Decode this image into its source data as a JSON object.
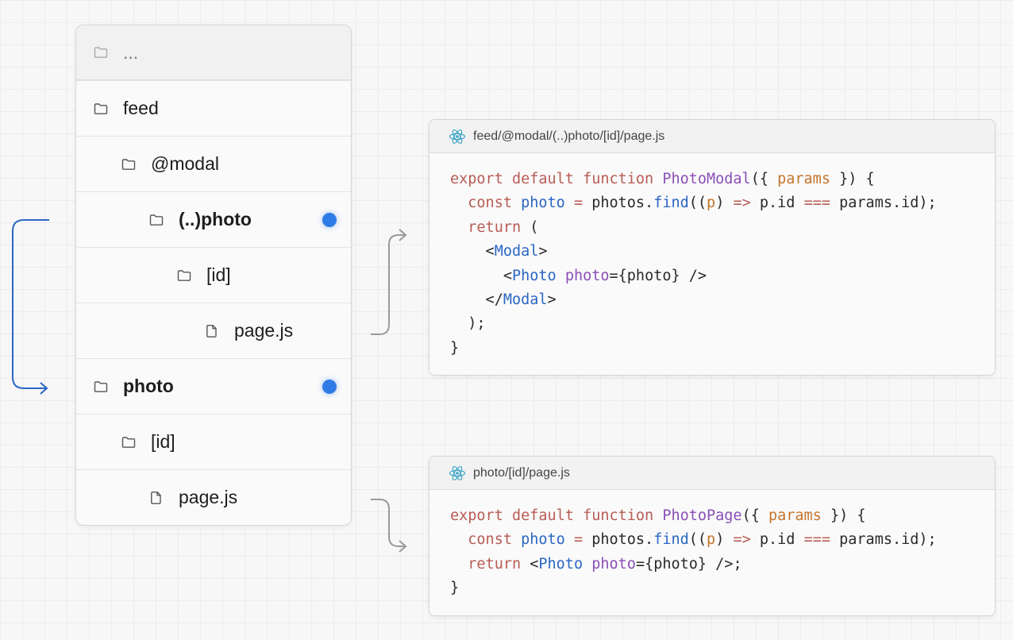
{
  "tree": {
    "rows": [
      {
        "label": "...",
        "type": "folder",
        "indent": 0,
        "bold": false,
        "dim": true,
        "dot": false
      },
      {
        "label": "feed",
        "type": "folder",
        "indent": 0,
        "bold": false,
        "dim": false,
        "dot": false
      },
      {
        "label": "@modal",
        "type": "folder",
        "indent": 1,
        "bold": false,
        "dim": false,
        "dot": false
      },
      {
        "label": "(..)photo",
        "type": "folder",
        "indent": 2,
        "bold": true,
        "dim": false,
        "dot": true
      },
      {
        "label": "[id]",
        "type": "folder",
        "indent": 3,
        "bold": false,
        "dim": false,
        "dot": false
      },
      {
        "label": "page.js",
        "type": "file",
        "indent": 4,
        "bold": false,
        "dim": false,
        "dot": false
      },
      {
        "label": "photo",
        "type": "folder",
        "indent": 0,
        "bold": true,
        "dim": false,
        "dot": true
      },
      {
        "label": "[id]",
        "type": "folder",
        "indent": 1,
        "bold": false,
        "dim": false,
        "dot": false
      },
      {
        "label": "page.js",
        "type": "file",
        "indent": 2,
        "bold": false,
        "dim": false,
        "dot": false
      }
    ]
  },
  "cards": [
    {
      "filename": "feed/@modal/(..)photo/[id]/page.js",
      "lines": [
        [
          [
            "kw",
            "export default function "
          ],
          [
            "fn",
            "PhotoModal"
          ],
          [
            "",
            "({ "
          ],
          [
            "pr",
            "params"
          ],
          [
            "",
            " }) {"
          ]
        ],
        [
          [
            "",
            "  "
          ],
          [
            "kw",
            "const "
          ],
          [
            "bl",
            "photo"
          ],
          [
            "",
            " "
          ],
          [
            "kw",
            "="
          ],
          [
            "",
            " photos."
          ],
          [
            "bl",
            "find"
          ],
          [
            "",
            "(("
          ],
          [
            "pr",
            "p"
          ],
          [
            "",
            ") "
          ],
          [
            "kw",
            "=>"
          ],
          [
            "",
            " p.id "
          ],
          [
            "kw",
            "==="
          ],
          [
            "",
            " params.id);"
          ]
        ],
        [
          [
            "",
            "  "
          ],
          [
            "kw",
            "return"
          ],
          [
            "",
            " ("
          ]
        ],
        [
          [
            "",
            "    <"
          ],
          [
            "tg",
            "Modal"
          ],
          [
            "",
            ">"
          ]
        ],
        [
          [
            "",
            "      <"
          ],
          [
            "tg",
            "Photo"
          ],
          [
            "",
            " "
          ],
          [
            "at",
            "photo"
          ],
          [
            "",
            "={photo} />"
          ]
        ],
        [
          [
            "",
            "    </"
          ],
          [
            "tg",
            "Modal"
          ],
          [
            "",
            ">"
          ]
        ],
        [
          [
            "",
            "  );"
          ]
        ],
        [
          [
            "",
            "}"
          ]
        ]
      ]
    },
    {
      "filename": "photo/[id]/page.js",
      "lines": [
        [
          [
            "kw",
            "export default function "
          ],
          [
            "fn",
            "PhotoPage"
          ],
          [
            "",
            "({ "
          ],
          [
            "pr",
            "params"
          ],
          [
            "",
            " }) {"
          ]
        ],
        [
          [
            "",
            "  "
          ],
          [
            "kw",
            "const "
          ],
          [
            "bl",
            "photo"
          ],
          [
            "",
            " "
          ],
          [
            "kw",
            "="
          ],
          [
            "",
            " photos."
          ],
          [
            "bl",
            "find"
          ],
          [
            "",
            "(("
          ],
          [
            "pr",
            "p"
          ],
          [
            "",
            ") "
          ],
          [
            "kw",
            "=>"
          ],
          [
            "",
            " p.id "
          ],
          [
            "kw",
            "==="
          ],
          [
            "",
            " params.id);"
          ]
        ],
        [
          [
            "",
            "  "
          ],
          [
            "kw",
            "return"
          ],
          [
            "",
            " <"
          ],
          [
            "tg",
            "Photo"
          ],
          [
            "",
            " "
          ],
          [
            "at",
            "photo"
          ],
          [
            "",
            "={photo} />;"
          ]
        ],
        [
          [
            "",
            "}"
          ]
        ]
      ]
    }
  ],
  "colors": {
    "dot": "#2f7be6",
    "route_arrow": "#2a66c4",
    "connector": "#9a9a9a"
  }
}
